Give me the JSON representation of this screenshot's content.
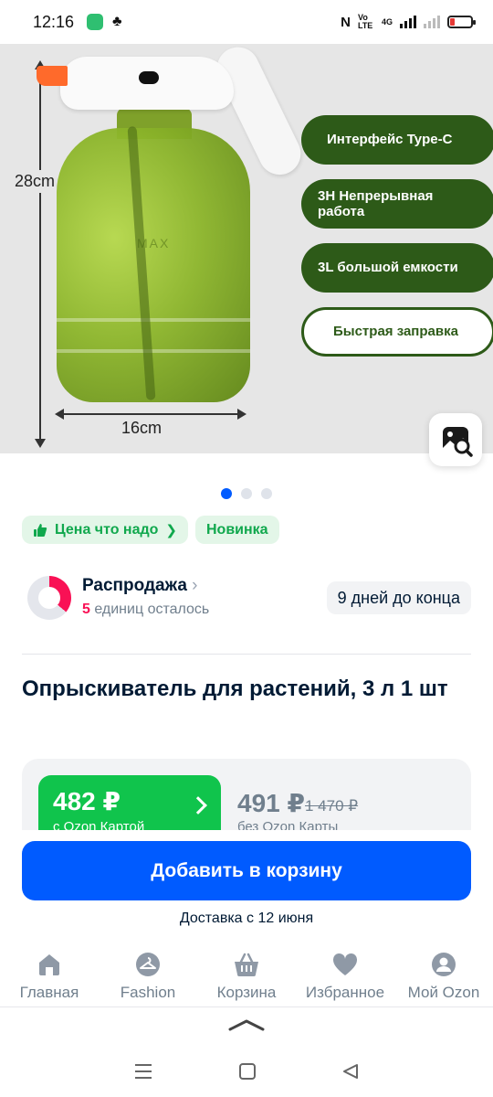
{
  "status_bar": {
    "time": "12:16",
    "network": "4G",
    "volte": "Vo LTE"
  },
  "gallery": {
    "height_label": "28cm",
    "width_label": "16cm",
    "bottle_text": "MAX",
    "features": [
      "Интерфейс Type-C",
      "3H Непрерывная работа",
      "3L большой емкости",
      "Быстрая заправка"
    ],
    "current_slide": 1,
    "total_slides": 3
  },
  "badges": {
    "price_badge": "Цена что надо",
    "new_badge": "Новинка"
  },
  "sale": {
    "title": "Распродажа",
    "units_count": "5",
    "units_text": "единиц осталось",
    "days_left": "9 дней до конца",
    "ring_color": "#f91155"
  },
  "product": {
    "title": "Опрыскиватель для растений, 3 л 1 шт"
  },
  "price": {
    "ozon_price": "482 ₽",
    "ozon_card_label": "с Ozon Картой",
    "regular_price": "491 ₽",
    "old_price": "1 470 ₽",
    "no_card_label": "без Ozon Карты"
  },
  "cart": {
    "add_button": "Добавить в корзину",
    "delivery": "Доставка с 12 июня"
  },
  "nav": {
    "items": [
      {
        "label": "Главная",
        "icon": "home-icon"
      },
      {
        "label": "Fashion",
        "icon": "hanger-icon"
      },
      {
        "label": "Корзина",
        "icon": "basket-icon"
      },
      {
        "label": "Избранное",
        "icon": "heart-icon"
      },
      {
        "label": "Мой Ozon",
        "icon": "profile-icon"
      }
    ]
  },
  "colors": {
    "accent_blue": "#005bff",
    "green_price": "#10c44c",
    "badge_green": "#10a84d",
    "feature_green": "#2d5a18"
  }
}
